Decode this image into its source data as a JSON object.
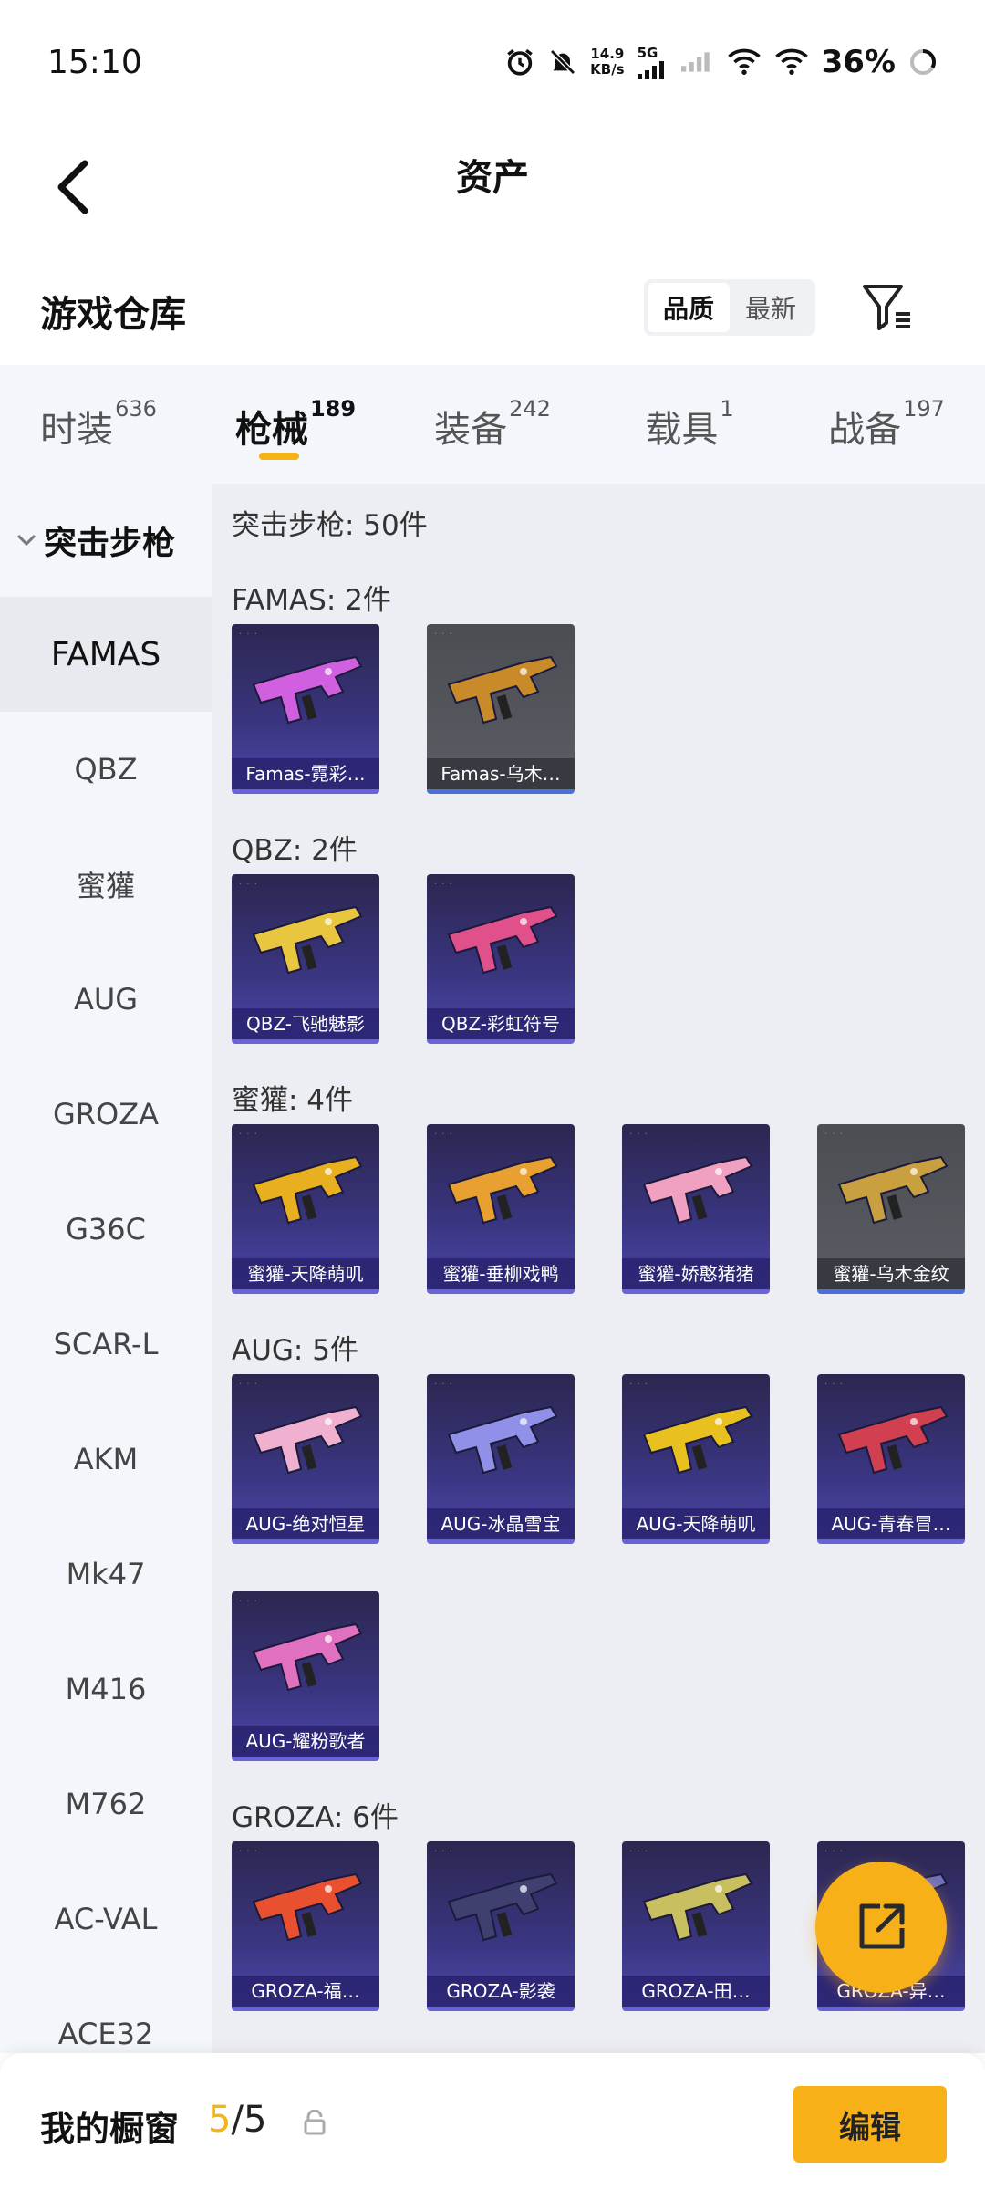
{
  "status": {
    "time": "15:10",
    "speed_value": "14.9",
    "speed_unit": "KB/s",
    "network": "5G",
    "battery": "36%"
  },
  "header": {
    "title": "资产"
  },
  "toolbar": {
    "warehouse_title": "游戏仓库",
    "sort_options": [
      "品质",
      "最新"
    ],
    "active_sort": "品质"
  },
  "tabs": [
    {
      "label": "时装",
      "count": "636"
    },
    {
      "label": "枪械",
      "count": "189"
    },
    {
      "label": "装备",
      "count": "242"
    },
    {
      "label": "载具",
      "count": "1"
    },
    {
      "label": "战备",
      "count": "197"
    }
  ],
  "active_tab": "枪械",
  "sidebar": {
    "header": "突击步枪",
    "items": [
      "FAMAS",
      "QBZ",
      "蜜獾",
      "AUG",
      "GROZA",
      "G36C",
      "SCAR-L",
      "AKM",
      "Mk47",
      "M416",
      "M762",
      "AC-VAL",
      "ACE32"
    ],
    "active": "FAMAS"
  },
  "content": {
    "summary": "突击步枪: 50件",
    "groups": [
      {
        "title": "FAMAS: 2件",
        "items": [
          {
            "name": "Famas-霓彩…",
            "frame": "purple",
            "color": "#d060e0"
          },
          {
            "name": "Famas-乌木…",
            "frame": "gray",
            "color": "#c98a2a"
          }
        ]
      },
      {
        "title": "QBZ: 2件",
        "items": [
          {
            "name": "QBZ-飞驰魅影",
            "frame": "purple",
            "color": "#e8c640"
          },
          {
            "name": "QBZ-彩虹符号",
            "frame": "purple",
            "color": "#e0508a"
          }
        ]
      },
      {
        "title": "蜜獾: 4件",
        "items": [
          {
            "name": "蜜獾-天降萌叽",
            "frame": "purple",
            "color": "#e8b020"
          },
          {
            "name": "蜜獾-垂柳戏鸭",
            "frame": "purple",
            "color": "#e8a030"
          },
          {
            "name": "蜜獾-娇憨猪猪",
            "frame": "purple",
            "color": "#f0a0c0"
          },
          {
            "name": "蜜獾-乌木金纹",
            "frame": "gray",
            "color": "#c8a040"
          }
        ]
      },
      {
        "title": "AUG: 5件",
        "items": [
          {
            "name": "AUG-绝对恒星",
            "frame": "purple",
            "color": "#f0b0d0"
          },
          {
            "name": "AUG-冰晶雪宝",
            "frame": "purple",
            "color": "#9090e8"
          },
          {
            "name": "AUG-天降萌叽",
            "frame": "purple",
            "color": "#e8c020"
          },
          {
            "name": "AUG-青春冒…",
            "frame": "purple",
            "color": "#d04050"
          },
          {
            "name": "AUG-耀粉歌者",
            "frame": "purple",
            "color": "#e070c0"
          }
        ]
      },
      {
        "title": "GROZA: 6件",
        "items": [
          {
            "name": "GROZA-福…",
            "frame": "purple",
            "color": "#e85030"
          },
          {
            "name": "GROZA-影袭",
            "frame": "purple",
            "color": "#404070"
          },
          {
            "name": "GROZA-田…",
            "frame": "purple",
            "color": "#c8c060"
          },
          {
            "name": "GROZA-异…",
            "frame": "purple",
            "color": "#7070c0"
          }
        ]
      }
    ]
  },
  "bottom": {
    "label": "我的橱窗",
    "current": "5",
    "separator": "/",
    "total": "5",
    "edit_label": "编辑"
  },
  "colors": {
    "accent": "#f8b019",
    "frame_purple": "#3a3580",
    "frame_gray": "#5b5d64"
  }
}
